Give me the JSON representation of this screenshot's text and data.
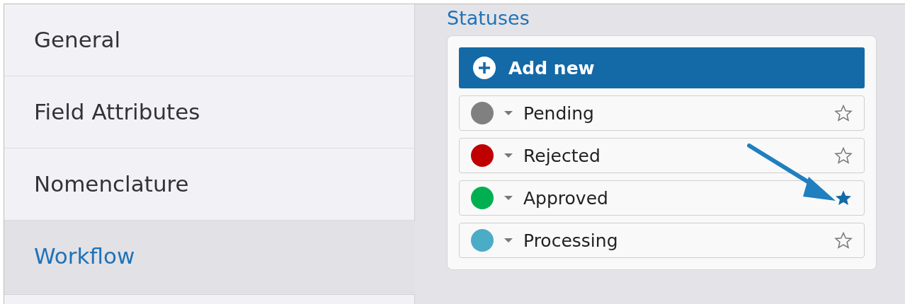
{
  "sidebar": {
    "items": [
      {
        "label": "General",
        "selected": false
      },
      {
        "label": "Field Attributes",
        "selected": false
      },
      {
        "label": "Nomenclature",
        "selected": false
      },
      {
        "label": "Workflow",
        "selected": true
      }
    ]
  },
  "section_title": "Statuses",
  "add_button": {
    "label": "Add new"
  },
  "statuses": [
    {
      "name": "Pending",
      "color": "#808080",
      "default": false
    },
    {
      "name": "Rejected",
      "color": "#c00000",
      "default": false
    },
    {
      "name": "Approved",
      "color": "#00b050",
      "default": true
    },
    {
      "name": "Processing",
      "color": "#4bacc6",
      "default": false
    }
  ]
}
